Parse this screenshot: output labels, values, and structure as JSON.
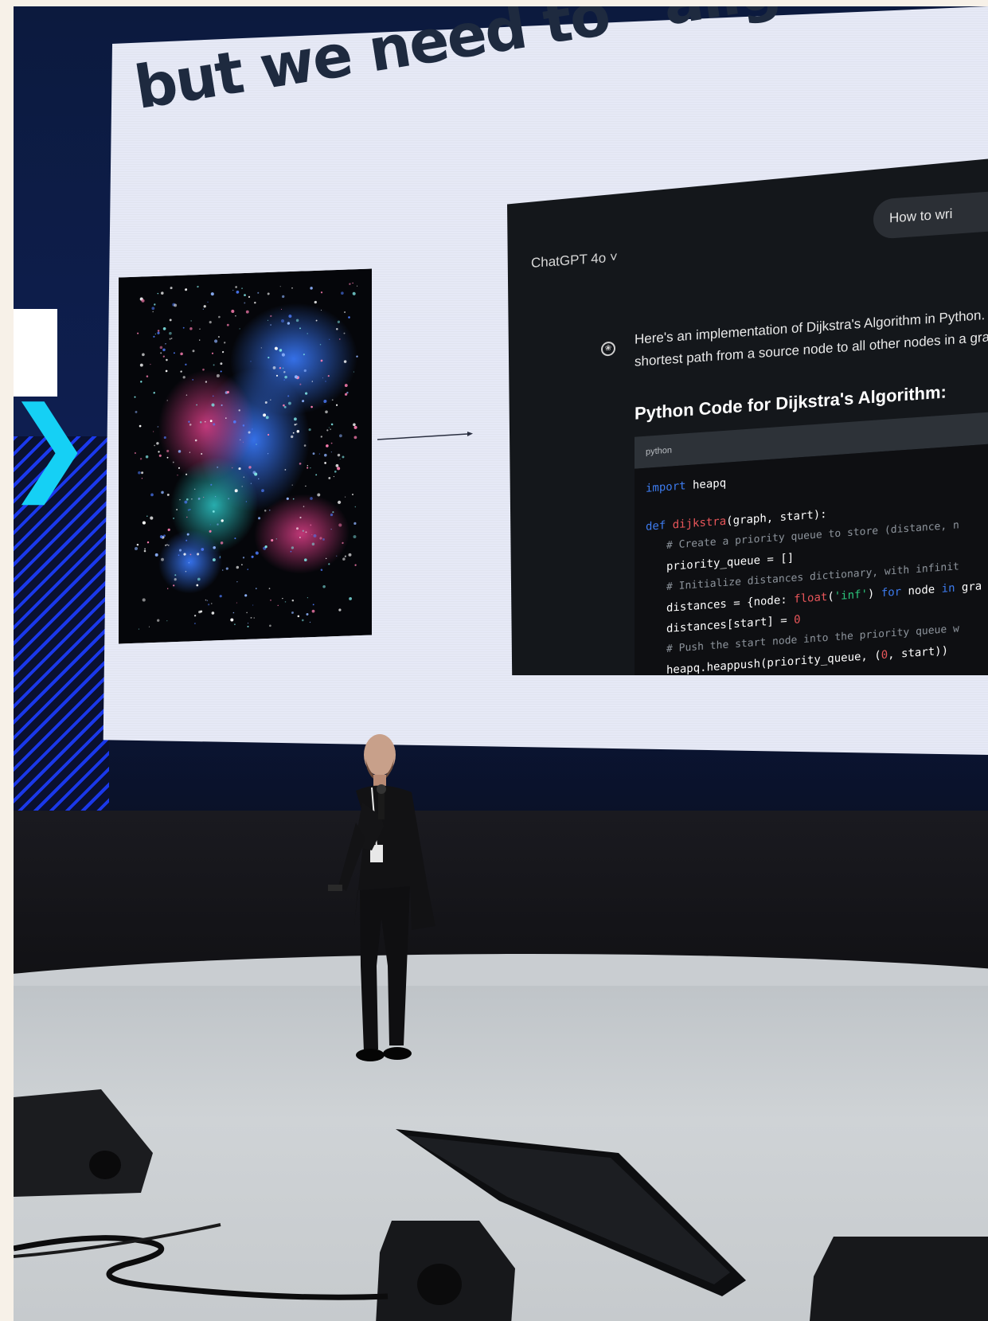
{
  "slide": {
    "title": "but we need to “align” it for as"
  },
  "chat_panel": {
    "model_selector": "ChatGPT 4o ˅",
    "user_prompt": "How to wri",
    "response_line_1": "Here's an implementation of Dijkstra's Algorithm in Python. Dijk",
    "response_line_2": "shortest path from a source node to all other nodes in a graph w",
    "code_heading": "Python Code for Dijkstra's Algorithm:",
    "code_language": "python",
    "code": {
      "l1_kw": "import",
      "l1_rest": " heapq",
      "l2_kw": "def",
      "l2_fn": "dijkstra",
      "l2_rest": "(graph, start):",
      "l3": "# Create a priority queue to store (distance, n",
      "l4": "priority_queue = []",
      "l5": "# Initialize distances dictionary, with infinit",
      "l6_a": "distances = {node: ",
      "l6_fn": "float",
      "l6_b": "(",
      "l6_str": "'inf'",
      "l6_c": ") ",
      "l6_kw": "for",
      "l6_d": " node ",
      "l6_kw2": "in",
      "l6_e": " gra",
      "l7_a": "distances[start] = ",
      "l7_num": "0",
      "l8": "# Push the start node into the priority queue w",
      "l9_a": "heapq.heappush(priority_queue, (",
      "l9_num": "0",
      "l9_b": ", start))"
    }
  },
  "colors": {
    "screen": "#e6e9f6",
    "panel": "#14171b",
    "led_cyan": "#15d0f5",
    "led_blue": "#1c3cff"
  }
}
